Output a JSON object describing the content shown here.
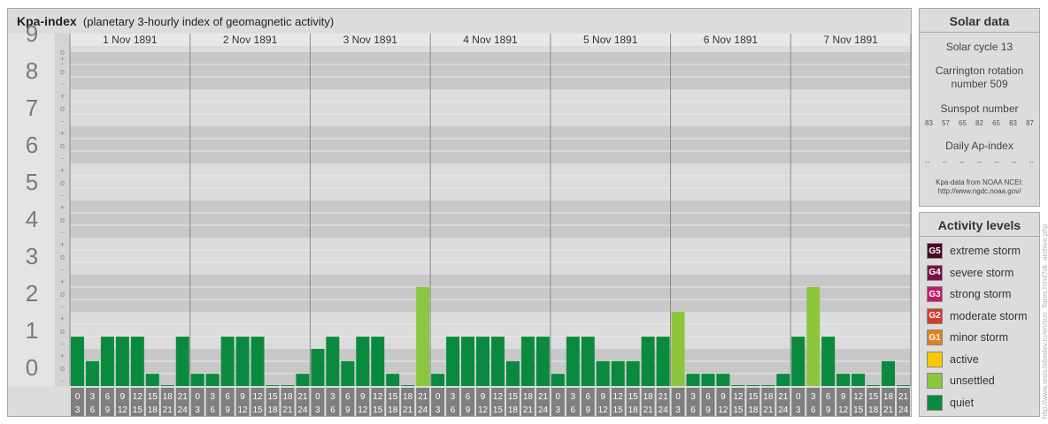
{
  "title": "Kpa-index",
  "subtitle": "(planetary 3-hourly index of geomagnetic activity)",
  "colors": {
    "quiet": "#0a8a3e",
    "unsettled": "#8cc63e",
    "active": "#f8c800",
    "minor_storm": "#e87e18",
    "moderate_storm": "#d83c28",
    "strong_storm": "#c41a6e",
    "severe_storm": "#7a1046",
    "extreme_storm": "#4a0828"
  },
  "chart_data": {
    "type": "bar",
    "ylabel": "",
    "ylim": [
      0,
      9
    ],
    "y_ticks": [
      "0",
      "1",
      "2",
      "3",
      "4",
      "5",
      "6",
      "7",
      "8",
      "9"
    ],
    "sub_ticks": [
      "-",
      "o",
      "+"
    ],
    "days": [
      "1 Nov 1891",
      "2 Nov 1891",
      "3 Nov 1891",
      "4 Nov 1891",
      "5 Nov 1891",
      "6 Nov 1891",
      "7 Nov 1891"
    ],
    "interval_labels": [
      [
        "0",
        "3"
      ],
      [
        "3",
        "6"
      ],
      [
        "6",
        "9"
      ],
      [
        "9",
        "12"
      ],
      [
        "12",
        "15"
      ],
      [
        "15",
        "18"
      ],
      [
        "18",
        "21"
      ],
      [
        "21",
        "24"
      ]
    ],
    "values": [
      1.33,
      0.67,
      1.33,
      1.33,
      1.33,
      0.33,
      0,
      1.33,
      0.33,
      0.33,
      1.33,
      1.33,
      1.33,
      0,
      0,
      0.33,
      1,
      1.33,
      0.67,
      1.33,
      1.33,
      0.33,
      0,
      2.67,
      0.33,
      1.33,
      1.33,
      1.33,
      1.33,
      0.67,
      1.33,
      1.33,
      0.33,
      1.33,
      1.33,
      0.67,
      0.67,
      0.67,
      1.33,
      1.33,
      2,
      0.33,
      0.33,
      0.33,
      0,
      0,
      0,
      0.33,
      1.33,
      2.67,
      1.33,
      0.33,
      0.33,
      0,
      0.67,
      0
    ],
    "categories": [
      "quiet",
      "quiet",
      "quiet",
      "quiet",
      "quiet",
      "quiet",
      "quiet",
      "quiet",
      "quiet",
      "quiet",
      "quiet",
      "quiet",
      "quiet",
      "quiet",
      "quiet",
      "quiet",
      "quiet",
      "quiet",
      "quiet",
      "quiet",
      "quiet",
      "quiet",
      "quiet",
      "unsettled",
      "quiet",
      "quiet",
      "quiet",
      "quiet",
      "quiet",
      "quiet",
      "quiet",
      "quiet",
      "quiet",
      "quiet",
      "quiet",
      "quiet",
      "quiet",
      "quiet",
      "quiet",
      "quiet",
      "unsettled",
      "quiet",
      "quiet",
      "quiet",
      "quiet",
      "quiet",
      "quiet",
      "quiet",
      "quiet",
      "unsettled",
      "quiet",
      "quiet",
      "quiet",
      "quiet",
      "quiet",
      "quiet"
    ]
  },
  "solar": {
    "header": "Solar data",
    "cycle": "Solar cycle 13",
    "carrington_1": "Carrington rotation",
    "carrington_2": "number 509",
    "sunspot_label": "Sunspot number",
    "sunspot_values": [
      "83",
      "57",
      "65",
      "82",
      "65",
      "83",
      "87"
    ],
    "ap_label": "Daily Ap-index",
    "ap_values": [
      "--",
      "--",
      "--",
      "--",
      "--",
      "--",
      "--"
    ],
    "source_1": "Kpa-data from NOAA NCEI:",
    "source_2": "http://www.ngdc.noaa.gov/"
  },
  "activity": {
    "header": "Activity levels",
    "items": [
      {
        "badge": "G5",
        "label": "extreme storm",
        "color": "#4a0828"
      },
      {
        "badge": "G4",
        "label": "severe storm",
        "color": "#7a1046"
      },
      {
        "badge": "G3",
        "label": "strong storm",
        "color": "#c41a6e"
      },
      {
        "badge": "G2",
        "label": "moderate storm",
        "color": "#d83c28"
      },
      {
        "badge": "G1",
        "label": "minor storm",
        "color": "#e87e18"
      },
      {
        "badge": "",
        "label": "active",
        "color": "#f8c800"
      },
      {
        "badge": "",
        "label": "unsettled",
        "color": "#8cc63e"
      },
      {
        "badge": "",
        "label": "quiet",
        "color": "#0a8a3e"
      }
    ]
  },
  "credit": "http://www.tesis.lebedev.ru/en/sun_flares.html?sk_archive.php"
}
